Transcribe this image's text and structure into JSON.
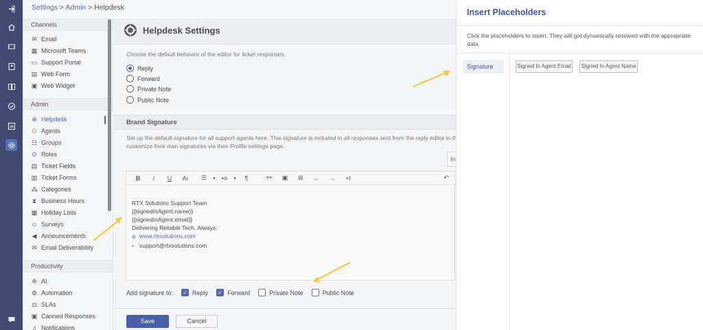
{
  "breadcrumb": {
    "settings": "Settings",
    "admin": "Admin",
    "current": "Helpdesk",
    "sep": ">"
  },
  "rail_icons": [
    "logout-icon",
    "home-icon",
    "ticket-icon",
    "contact-icon",
    "knowledge-icon",
    "check-icon",
    "report-icon",
    "settings-icon",
    "chat-icon"
  ],
  "sidebar": {
    "channels_title": "Channels",
    "channels": [
      {
        "label": "Email",
        "icon": "mail-icon"
      },
      {
        "label": "Microsoft Teams",
        "icon": "teams-icon"
      },
      {
        "label": "Support Portal",
        "icon": "portal-icon"
      },
      {
        "label": "Web Form",
        "icon": "form-icon"
      },
      {
        "label": "Web Widget",
        "icon": "widget-icon"
      }
    ],
    "admin_title": "Admin",
    "admin": [
      {
        "label": "Helpdesk",
        "icon": "helpdesk-icon",
        "active": true
      },
      {
        "label": "Agents",
        "icon": "agent-icon"
      },
      {
        "label": "Groups",
        "icon": "group-icon"
      },
      {
        "label": "Roles",
        "icon": "role-icon"
      },
      {
        "label": "Ticket Fields",
        "icon": "fields-icon"
      },
      {
        "label": "Ticket Forms",
        "icon": "forms-icon"
      },
      {
        "label": "Categories",
        "icon": "category-icon"
      },
      {
        "label": "Business Hours",
        "icon": "hourglass-icon"
      },
      {
        "label": "Holiday Lists",
        "icon": "holiday-icon"
      },
      {
        "label": "Surveys",
        "icon": "survey-icon"
      },
      {
        "label": "Announcements",
        "icon": "megaphone-icon"
      },
      {
        "label": "Email Deliverability",
        "icon": "deliverability-icon"
      }
    ],
    "productivity_title": "Productivity",
    "productivity": [
      {
        "label": "AI",
        "icon": "ai-icon"
      },
      {
        "label": "Automation",
        "icon": "automation-icon"
      },
      {
        "label": "SLAs",
        "icon": "sla-icon"
      },
      {
        "label": "Canned Responses",
        "icon": "canned-icon"
      },
      {
        "label": "Notifications",
        "icon": "bell-icon"
      }
    ]
  },
  "main": {
    "title": "Helpdesk Settings",
    "editor_behavior_desc": "Choose the default behavior of the editor for ticket responses.",
    "behavior_options": [
      {
        "label": "Reply",
        "selected": true
      },
      {
        "label": "Forward",
        "selected": false
      },
      {
        "label": "Private Note",
        "selected": false
      },
      {
        "label": "Public Note",
        "selected": false
      }
    ],
    "brand_signature_title": "Brand Signature",
    "brand_signature_desc_1": "Set up the default signature for all support agents here. This signature is included in all responses sent from the reply editor in the",
    "brand_signature_desc_2": "customize their own signatures via their Profile settings page.",
    "insert_btn_label": "In",
    "signature_lines": {
      "line1": "RTX Solutions Support Team",
      "line2": "{{signedInAgent.name}}",
      "line3": "{{signedInAgent.email}}",
      "line4": "Delivering Reliable Tech. Always.",
      "website": "www.rtxsolutions.com",
      "email": "support@rtxsolutions.com"
    },
    "add_signature_label": "Add signature to:",
    "add_signature_options": [
      {
        "label": "Reply",
        "checked": true
      },
      {
        "label": "Forward",
        "checked": true
      },
      {
        "label": "Private Note",
        "checked": false
      },
      {
        "label": "Public Note",
        "checked": false
      }
    ],
    "save_label": "Save",
    "cancel_label": "Cancel"
  },
  "toolbar_glyphs": {
    "bold": "B",
    "italic": "i",
    "underline": "U",
    "textsize": "Aı",
    "ol": "☰",
    "ul": "•≡",
    "para": "¶",
    "link": "⚯",
    "image": "▣",
    "table": "⊞",
    "undo": "←",
    "redo": "→",
    "clear": "+I",
    "more": "↶",
    "caret": "▾"
  },
  "drawer": {
    "title": "Insert Placeholders",
    "description": "Click the placeholders to insert. They will get dynamically resolved with the appropriate data.",
    "tab_signature": "Signature",
    "placeholders": [
      "Signed In Agent Email",
      "Signed In Agent Name"
    ]
  },
  "colors": {
    "rail": "#27335f",
    "accent": "#3a55b0",
    "save": "#2f4a9e",
    "arrow": "#f5c842"
  }
}
